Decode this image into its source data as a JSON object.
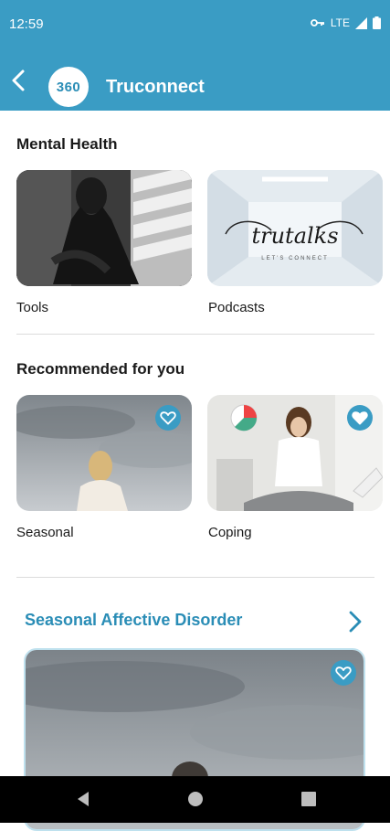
{
  "status_bar": {
    "time": "12:59",
    "network": "LTE"
  },
  "app_bar": {
    "logo_text": "360",
    "title": "Truconnect"
  },
  "mental_health": {
    "title": "Mental Health",
    "cards": [
      {
        "label": "Tools"
      },
      {
        "label": "Podcasts",
        "image_text": "trutalks",
        "image_subtext": "LET'S CONNECT"
      }
    ]
  },
  "recommended": {
    "title": "Recommended for you",
    "cards": [
      {
        "label": "Seasonal",
        "favorited": false
      },
      {
        "label": "Coping",
        "favorited": true
      }
    ]
  },
  "sad_section": {
    "title": "Seasonal Affective Disorder"
  },
  "colors": {
    "brand": "#3a9cc4",
    "link": "#2a8db6"
  },
  "icons": [
    "back-arrow-icon",
    "key-icon",
    "signal-icon",
    "battery-icon",
    "heart-icon",
    "chevron-right-icon",
    "nav-back-icon",
    "nav-home-icon",
    "nav-recents-icon"
  ]
}
